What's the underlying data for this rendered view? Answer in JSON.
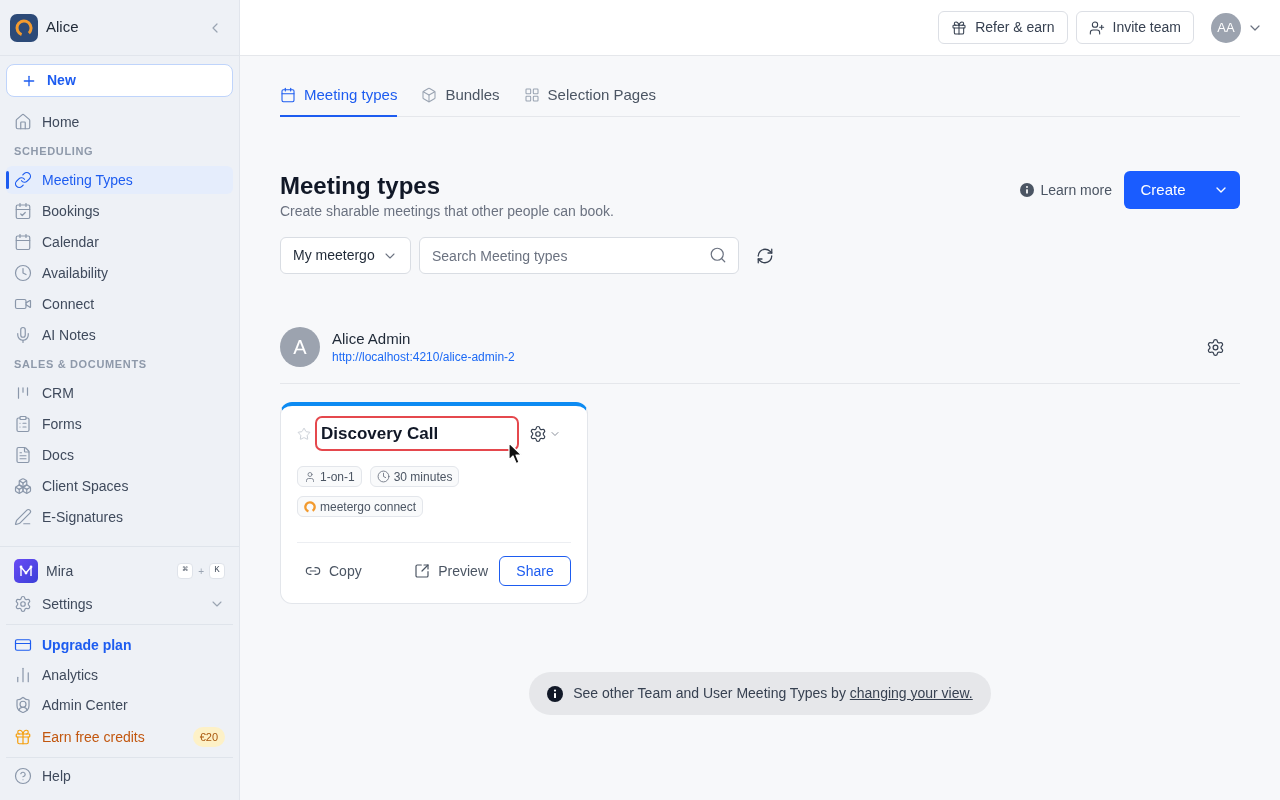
{
  "sidebar": {
    "workspace": {
      "name": "Alice"
    },
    "new_button": "New",
    "sections": [
      {
        "items": [
          {
            "label": "Home",
            "selected": false
          }
        ]
      },
      {
        "heading": "SCHEDULING",
        "items": [
          {
            "label": "Meeting Types",
            "selected": true
          },
          {
            "label": "Bookings",
            "selected": false
          },
          {
            "label": "Calendar",
            "selected": false
          },
          {
            "label": "Availability",
            "selected": false
          },
          {
            "label": "Connect",
            "selected": false
          },
          {
            "label": "AI Notes",
            "selected": false
          }
        ]
      },
      {
        "heading": "SALES & DOCUMENTS",
        "items": [
          {
            "label": "CRM",
            "selected": false
          },
          {
            "label": "Forms",
            "selected": false
          },
          {
            "label": "Docs",
            "selected": false
          },
          {
            "label": "Client Spaces",
            "selected": false
          },
          {
            "label": "E-Signatures",
            "selected": false
          }
        ]
      }
    ],
    "assistant": {
      "label": "Mira",
      "shortcut": [
        {
          "kind": "key",
          "text": "⌘"
        },
        {
          "kind": "plus",
          "text": "+"
        },
        {
          "kind": "key",
          "text": "K"
        }
      ]
    },
    "settings": {
      "label": "Settings",
      "expanded": false
    },
    "footer_items": [
      {
        "kind": "upgrade",
        "label": "Upgrade plan"
      },
      {
        "kind": "plain",
        "label": "Analytics"
      },
      {
        "kind": "plain",
        "label": "Admin Center"
      },
      {
        "kind": "reward",
        "label": "Earn free credits",
        "badge": "€20"
      }
    ],
    "help": {
      "label": "Help"
    }
  },
  "header": {
    "buttons": [
      {
        "label": "Refer & earn"
      },
      {
        "label": "Invite team"
      }
    ],
    "avatar": {
      "initials": "AA"
    }
  },
  "tabs": [
    {
      "label": "Meeting types",
      "selected": true
    },
    {
      "label": "Bundles",
      "selected": false
    },
    {
      "label": "Selection Pages",
      "selected": false
    }
  ],
  "page": {
    "title": "Meeting types",
    "subtitle": "Create sharable meetings that other people can book.",
    "learn_more": "Learn more",
    "create_button": "Create"
  },
  "filters": {
    "view": {
      "value": "My meetergo"
    },
    "search": {
      "placeholder": "Search Meeting types"
    }
  },
  "owner": {
    "initial": "A",
    "name": "Alice Admin",
    "url": "http://localhost:4210/alice-admin-2"
  },
  "cards": [
    {
      "title": "Discovery Call",
      "favorite": false,
      "highlighted": true,
      "tags": [
        {
          "kind": "participants",
          "label": "1-on-1"
        },
        {
          "kind": "duration",
          "label": "30 minutes"
        },
        {
          "kind": "location",
          "label": "meetergo connect"
        }
      ],
      "actions": [
        {
          "kind": "copy",
          "label": "Copy"
        },
        {
          "kind": "preview",
          "label": "Preview"
        },
        {
          "kind": "share",
          "label": "Share"
        }
      ]
    }
  ],
  "notice": {
    "text": "See other Team and User Meeting Types by",
    "link": "changing your view."
  }
}
